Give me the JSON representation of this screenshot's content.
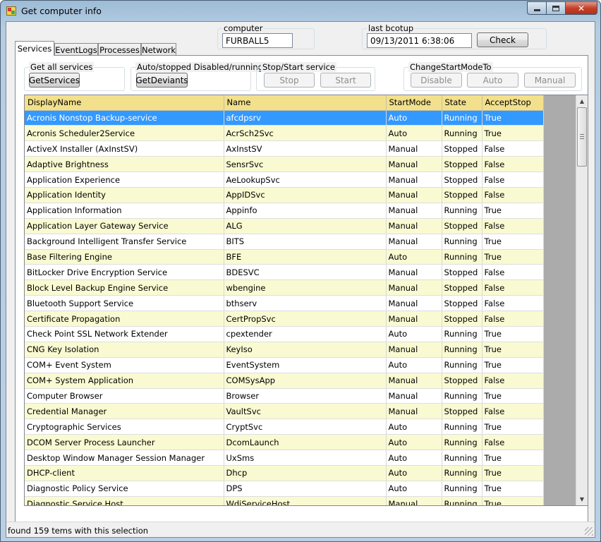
{
  "window": {
    "title": "Get computer info",
    "icon": "app-icon",
    "controls": [
      "minimize-icon",
      "maximize-icon",
      "close-icon"
    ],
    "close_glyph": "✕"
  },
  "header": {
    "computer_label": "computer",
    "computer_value": "FURBALL5",
    "lastboot_label": "last bcotup",
    "lastboot_value": "09/13/2011 6:38:06",
    "check_label": "Check"
  },
  "tabs": [
    {
      "label": "Services",
      "active": true
    },
    {
      "label": "EventLogs",
      "active": false
    },
    {
      "label": "Processes",
      "active": false
    },
    {
      "label": "Network",
      "active": false
    }
  ],
  "groups": {
    "get_all": {
      "label": "Get all services",
      "button": "GetServices"
    },
    "deviants": {
      "label": "Auto/stopped Disabled/running",
      "button": "GetDeviants"
    },
    "stopstart": {
      "label": "Stop/Start service",
      "stop": "Stop",
      "start": "Start"
    },
    "startmode": {
      "label": "ChangeStartModeTo",
      "disable": "Disable",
      "auto": "Auto",
      "manual": "Manual"
    }
  },
  "table": {
    "columns": [
      "DisplayName",
      "Name",
      "StartMode",
      "State",
      "AcceptStop"
    ],
    "selected_index": 0,
    "rows": [
      [
        "Acronis Nonstop Backup-service",
        "afcdpsrv",
        "Auto",
        "Running",
        "True"
      ],
      [
        "Acronis Scheduler2Service",
        "AcrSch2Svc",
        "Auto",
        "Running",
        "True"
      ],
      [
        "ActiveX Installer (AxInstSV)",
        "AxInstSV",
        "Manual",
        "Stopped",
        "False"
      ],
      [
        "Adaptive Brightness",
        "SensrSvc",
        "Manual",
        "Stopped",
        "False"
      ],
      [
        "Application Experience",
        "AeLookupSvc",
        "Manual",
        "Stopped",
        "False"
      ],
      [
        "Application Identity",
        "AppIDSvc",
        "Manual",
        "Stopped",
        "False"
      ],
      [
        "Application Information",
        "Appinfo",
        "Manual",
        "Running",
        "True"
      ],
      [
        "Application Layer Gateway Service",
        "ALG",
        "Manual",
        "Stopped",
        "False"
      ],
      [
        "Background Intelligent Transfer Service",
        "BITS",
        "Manual",
        "Running",
        "True"
      ],
      [
        "Base Filtering Engine",
        "BFE",
        "Auto",
        "Running",
        "True"
      ],
      [
        "BitLocker Drive Encryption Service",
        "BDESVC",
        "Manual",
        "Stopped",
        "False"
      ],
      [
        "Block Level Backup Engine Service",
        "wbengine",
        "Manual",
        "Stopped",
        "False"
      ],
      [
        "Bluetooth Support Service",
        "bthserv",
        "Manual",
        "Stopped",
        "False"
      ],
      [
        "Certificate Propagation",
        "CertPropSvc",
        "Manual",
        "Stopped",
        "False"
      ],
      [
        "Check Point SSL Network Extender",
        "cpextender",
        "Auto",
        "Running",
        "True"
      ],
      [
        "CNG Key Isolation",
        "KeyIso",
        "Manual",
        "Running",
        "True"
      ],
      [
        "COM+ Event System",
        "EventSystem",
        "Auto",
        "Running",
        "True"
      ],
      [
        "COM+ System Application",
        "COMSysApp",
        "Manual",
        "Stopped",
        "False"
      ],
      [
        "Computer Browser",
        "Browser",
        "Manual",
        "Running",
        "True"
      ],
      [
        "Credential Manager",
        "VaultSvc",
        "Manual",
        "Stopped",
        "False"
      ],
      [
        "Cryptographic Services",
        "CryptSvc",
        "Auto",
        "Running",
        "True"
      ],
      [
        "DCOM Server Process Launcher",
        "DcomLaunch",
        "Auto",
        "Running",
        "False"
      ],
      [
        "Desktop Window Manager Session Manager",
        "UxSms",
        "Auto",
        "Running",
        "True"
      ],
      [
        "DHCP-client",
        "Dhcp",
        "Auto",
        "Running",
        "True"
      ],
      [
        "Diagnostic Policy Service",
        "DPS",
        "Auto",
        "Running",
        "True"
      ],
      [
        "Diagnostic Service Host",
        "WdiServiceHost",
        "Manual",
        "Running",
        "True"
      ]
    ]
  },
  "status": {
    "text": "found 159 tems with this selection"
  },
  "colors": {
    "header": "#f2e08c",
    "alt_row": "#fafad2",
    "selected": "#3399ff"
  }
}
